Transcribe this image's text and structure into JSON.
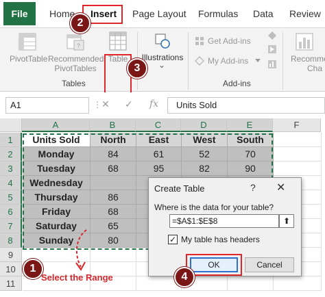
{
  "ribbon_tabs": {
    "file": "File",
    "home": "Home",
    "insert": "Insert",
    "page_layout": "Page Layout",
    "formulas": "Formulas",
    "data": "Data",
    "review": "Review"
  },
  "ribbon": {
    "pivottable": "PivotTable",
    "recommended_line1": "Recommended",
    "recommended_line2": "PivotTables",
    "table": "Table",
    "illustrations": "Illustrations",
    "illustrations_chevron": "⌄",
    "get_addins": "Get Add-ins",
    "my_addins": "My Add-ins",
    "recomme_line1": "Recomme",
    "recomme_line2": "Cha",
    "group_tables": "Tables",
    "group_addins": "Add-ins"
  },
  "markers": {
    "m1": "1",
    "m2": "2",
    "m3": "3",
    "m4": "4"
  },
  "formula_bar": {
    "name_box": "A1",
    "cancel": "✕",
    "enter": "✓",
    "fx": "fx",
    "content": "Units Sold"
  },
  "columns": [
    "A",
    "B",
    "C",
    "D",
    "E",
    "F"
  ],
  "rows": [
    "1",
    "2",
    "3",
    "4",
    "5",
    "6",
    "7",
    "8",
    "9",
    "10",
    "11"
  ],
  "table": {
    "headers": [
      "Units Sold",
      "North",
      "East",
      "West",
      "South"
    ],
    "data": [
      [
        "Monday",
        "84",
        "61",
        "52",
        "70"
      ],
      [
        "Tuesday",
        "68",
        "95",
        "82",
        "90"
      ],
      [
        "Wednesday",
        "",
        "",
        "",
        ""
      ],
      [
        "Thursday",
        "86",
        "",
        "",
        ""
      ],
      [
        "Friday",
        "68",
        "",
        "",
        ""
      ],
      [
        "Saturday",
        "65",
        "",
        "",
        ""
      ],
      [
        "Sunday",
        "80",
        "",
        "",
        ""
      ]
    ]
  },
  "callout": {
    "select_range": "Select the Range"
  },
  "dialog": {
    "title": "Create Table",
    "help": "?",
    "close": "✕",
    "prompt": "Where is the data for your table?",
    "range": "=$A$1:$E$8",
    "collapse": "⬆",
    "headers_checked": "✓",
    "headers_label": "My table has headers",
    "ok": "OK",
    "cancel": "Cancel"
  },
  "colors": {
    "excel_green": "#217346",
    "annotation_red": "#e0262a",
    "marker_dark_red": "#7a1616"
  }
}
